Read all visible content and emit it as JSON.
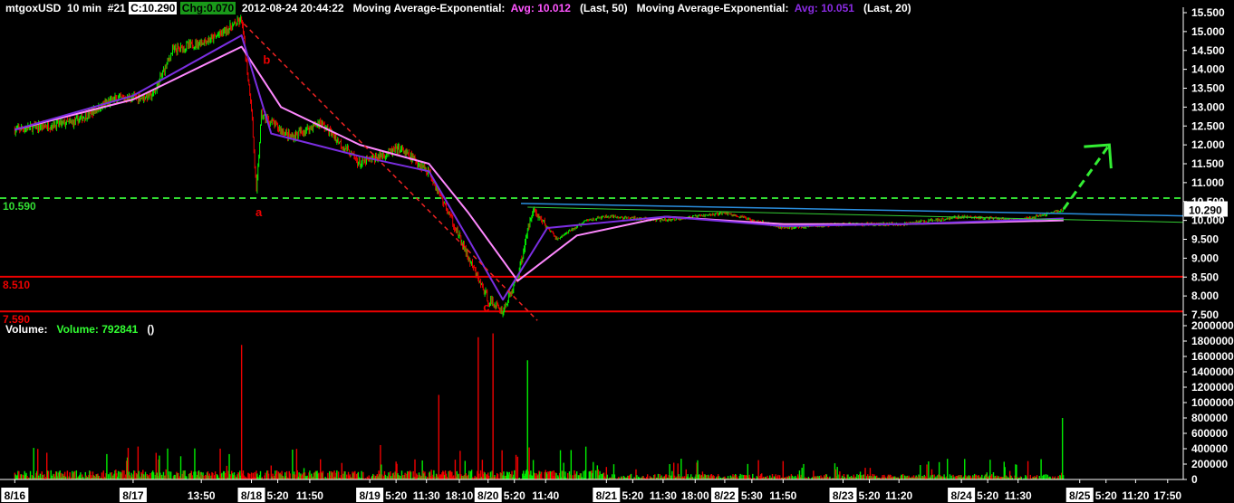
{
  "header": {
    "symbol": "mtgoxUSD",
    "interval": "10 min",
    "bar_no": "#21",
    "close": "C:10.290",
    "change": "Chg:0.070",
    "datetime": "2012-08-24 20:44:22",
    "ma1_label": "Moving Average-Exponential:",
    "ma1_avg": "Avg: 10.012",
    "ma1_param": "(Last, 50)",
    "ma2_label": "Moving Average-Exponential:",
    "ma2_avg": "Avg: 10.051",
    "ma2_param": "(Last, 20)"
  },
  "volume_header": {
    "label": "Volume:",
    "value": "Volume: 792841",
    "extra": "()"
  },
  "chart_data": {
    "type": "line",
    "price_axis": {
      "ylim": [
        7.5,
        15.5
      ],
      "ticks": [
        "15.500",
        "15.000",
        "14.500",
        "14.000",
        "13.500",
        "13.000",
        "12.500",
        "12.000",
        "11.500",
        "11.000",
        "10.500",
        "10.000",
        "9.500",
        "9.000",
        "8.500",
        "8.000",
        "7.500"
      ]
    },
    "volume_axis": {
      "ylim": [
        0,
        2000000
      ],
      "ticks": [
        "2000000",
        "1800000",
        "1600000",
        "1400000",
        "1200000",
        "1000000",
        "800000",
        "600000",
        "400000",
        "200000",
        "0"
      ]
    },
    "x_tick_labels": [
      "8/16",
      "8/17",
      "13:50",
      "8/18",
      "5:20",
      "11:50",
      "8/19",
      "5:20",
      "11:30",
      "18:10",
      "8/20",
      "5:20",
      "11:40",
      "8/21",
      "5:20",
      "11:30",
      "18:00",
      "8/22",
      "5:30",
      "11:50",
      "8/23",
      "5:20",
      "11:20",
      "8/24",
      "5:20",
      "11:30",
      "8/25",
      "5:20",
      "11:20",
      "17:50"
    ],
    "price_series": {
      "name": "mtgoxUSD",
      "points": [
        [
          "8/16 00:00",
          12.4
        ],
        [
          "8/16 12:00",
          12.6
        ],
        [
          "8/16 20:00",
          13.2
        ],
        [
          "8/17 04:00",
          13.3
        ],
        [
          "8/17 08:00",
          14.5
        ],
        [
          "8/17 16:00",
          14.8
        ],
        [
          "8/17 22:00",
          15.3
        ],
        [
          "8/18 00:00",
          13.0
        ],
        [
          "8/18 01:00",
          10.7
        ],
        [
          "8/18 02:00",
          12.8
        ],
        [
          "8/18 08:00",
          12.2
        ],
        [
          "8/18 14:00",
          12.6
        ],
        [
          "8/18 22:00",
          11.5
        ],
        [
          "8/19 06:00",
          11.9
        ],
        [
          "8/19 12:00",
          11.3
        ],
        [
          "8/19 16:00",
          10.2
        ],
        [
          "8/19 20:00",
          9.0
        ],
        [
          "8/20 00:00",
          7.9
        ],
        [
          "8/20 03:00",
          7.6
        ],
        [
          "8/20 06:00",
          8.5
        ],
        [
          "8/20 09:00",
          10.3
        ],
        [
          "8/20 14:00",
          9.5
        ],
        [
          "8/20 20:00",
          10.0
        ],
        [
          "8/21 00:00",
          10.1
        ],
        [
          "8/21 12:00",
          10.0
        ],
        [
          "8/22 00:00",
          10.2
        ],
        [
          "8/22 12:00",
          9.8
        ],
        [
          "8/23 00:00",
          9.9
        ],
        [
          "8/23 12:00",
          9.9
        ],
        [
          "8/24 00:00",
          10.1
        ],
        [
          "8/24 12:00",
          10.0
        ],
        [
          "8/24 20:44",
          10.29
        ]
      ]
    },
    "ema50": {
      "points": [
        [
          "8/16 00:00",
          12.4
        ],
        [
          "8/17 00:00",
          13.2
        ],
        [
          "8/17 22:00",
          14.6
        ],
        [
          "8/18 06:00",
          13.0
        ],
        [
          "8/18 22:00",
          12.0
        ],
        [
          "8/19 12:00",
          11.5
        ],
        [
          "8/19 20:00",
          10.2
        ],
        [
          "8/20 06:00",
          8.4
        ],
        [
          "8/20 18:00",
          9.6
        ],
        [
          "8/21 12:00",
          10.1
        ],
        [
          "8/22 12:00",
          9.9
        ],
        [
          "8/23 12:00",
          9.9
        ],
        [
          "8/24 20:44",
          10.0
        ]
      ]
    },
    "ema20": {
      "points": [
        [
          "8/16 00:00",
          12.4
        ],
        [
          "8/17 00:00",
          13.3
        ],
        [
          "8/17 22:00",
          14.9
        ],
        [
          "8/18 04:00",
          12.3
        ],
        [
          "8/18 22:00",
          11.7
        ],
        [
          "8/19 12:00",
          11.3
        ],
        [
          "8/19 20:00",
          9.5
        ],
        [
          "8/20 03:00",
          7.9
        ],
        [
          "8/20 12:00",
          9.8
        ],
        [
          "8/21 12:00",
          10.1
        ],
        [
          "8/22 12:00",
          9.85
        ],
        [
          "8/23 12:00",
          9.9
        ],
        [
          "8/24 20:44",
          10.05
        ]
      ]
    },
    "horizontal_lines": [
      {
        "label": "10.590",
        "value": 10.59,
        "style": "dashed",
        "color": "#33dd33"
      },
      {
        "label": "8.510",
        "value": 8.51,
        "style": "solid",
        "color": "#ee0000"
      },
      {
        "label": "7.590",
        "value": 7.59,
        "style": "solid",
        "color": "#ee0000"
      }
    ],
    "last_price_label": "10.290",
    "wave_labels": [
      "a",
      "b",
      "c"
    ],
    "volume": {
      "name": "Volume",
      "peaks": [
        {
          "time": "8/17 22:00",
          "value": 1750000
        },
        {
          "time": "8/19 22:00",
          "value": 1850000
        },
        {
          "time": "8/20 01:00",
          "value": 1900000
        },
        {
          "time": "8/20 08:00",
          "value": 1550000
        },
        {
          "time": "8/19 14:00",
          "value": 1100000
        },
        {
          "time": "8/24 20:30",
          "value": 800000
        }
      ]
    },
    "colors": {
      "up": "#00ee00",
      "down": "#ee0000",
      "ema50": "#ff88ff",
      "ema20": "#7a2ee0",
      "support": "#33dd33",
      "resistance": "#ee0000",
      "trend_blue": "#2a8fe0",
      "trend_green": "#33cc33",
      "downtrend": "#ee2222",
      "arrow": "#33ee33",
      "text": "#ffffff"
    }
  }
}
